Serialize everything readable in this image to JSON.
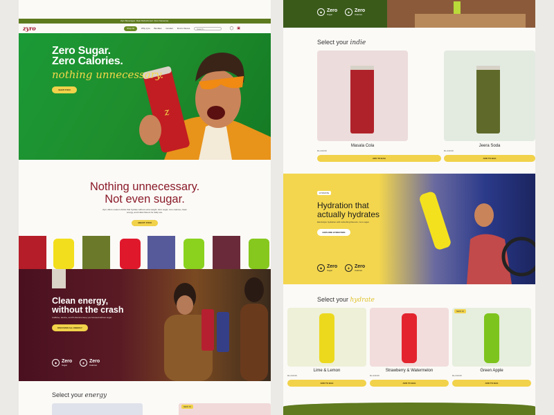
{
  "left": {
    "announcement": "Zyro Beverages. Real Refreshment. Zero Nonsense.",
    "logo": "zyro",
    "nav": {
      "shop_all": "Shop All",
      "links": [
        "Why zyro",
        "Bundles",
        "Contact",
        "Find in Stores"
      ],
      "search_placeholder": "Search..."
    },
    "hero": {
      "title_line1": "Zero Sugar.",
      "title_line2": "Zero Calories.",
      "italic": "nothing unnecessary.",
      "cta": "SHOP ZYRO"
    },
    "intro": {
      "title_line1": "Nothing unnecessary.",
      "title_line2": "Not even sugar.",
      "body": "Zyro offers modern drinks that hydrate without extra weight. Zero sugar, zero calories, clean energy, and Indian flavors for daily use.",
      "cta": "ABOUT ZYRO"
    },
    "energy": {
      "title_line1": "Clean energy,",
      "title_line2": "without the crash",
      "body": "Caffeine, taurine, and B vitamins keep you focused without sugar.",
      "cta": "DISCOVER ALL ENERGY",
      "badge1_t": "Zero",
      "badge1_s": "Sugar",
      "badge2_t": "Zero",
      "badge2_s": "Calories"
    },
    "select_prefix": "Select your",
    "select_word": "energy",
    "new_badge": "NEW IN"
  },
  "right": {
    "top_badge1_t": "Zero",
    "top_badge1_s": "Sugar",
    "top_badge2_t": "Zero",
    "top_badge2_s": "Calories",
    "indie": {
      "prefix": "Select your",
      "word": "indie",
      "products": [
        {
          "name": "Masala Cola",
          "price": "Rs.240.00",
          "cta": "ADD TO BAG"
        },
        {
          "name": "Jeera Soda",
          "price": "Rs.240.00",
          "cta": "ADD TO BAG"
        }
      ]
    },
    "hydration": {
      "badge": "HYDRATE",
      "title_line1": "Hydration that",
      "title_line2": "actually hydrates",
      "body": "Electrolyte hydration with refreshing flavours, zero sugar.",
      "cta": "EXPLORE HYDRATION",
      "badge1_t": "Zero",
      "badge1_s": "Sugar",
      "badge2_t": "Zero",
      "badge2_s": "Calories"
    },
    "hydrate": {
      "prefix": "Select your",
      "word": "hydrate",
      "products": [
        {
          "name": "Lime & Lemon",
          "price": "Rs.240.00",
          "cta": "ADD TO BAG"
        },
        {
          "name": "Strawberry & Watermelon",
          "price": "Rs.240.00",
          "cta": "ADD TO BAG"
        },
        {
          "name": "Green Apple",
          "price": "Rs.240.00",
          "cta": "ADD TO BAG",
          "badge": "NEW IN"
        }
      ]
    }
  },
  "colors": {
    "brand_red": "#a0142a",
    "brand_green": "#5e7a1f",
    "accent_yellow": "#f1d24a",
    "energy_maroon": "#4a1020"
  }
}
